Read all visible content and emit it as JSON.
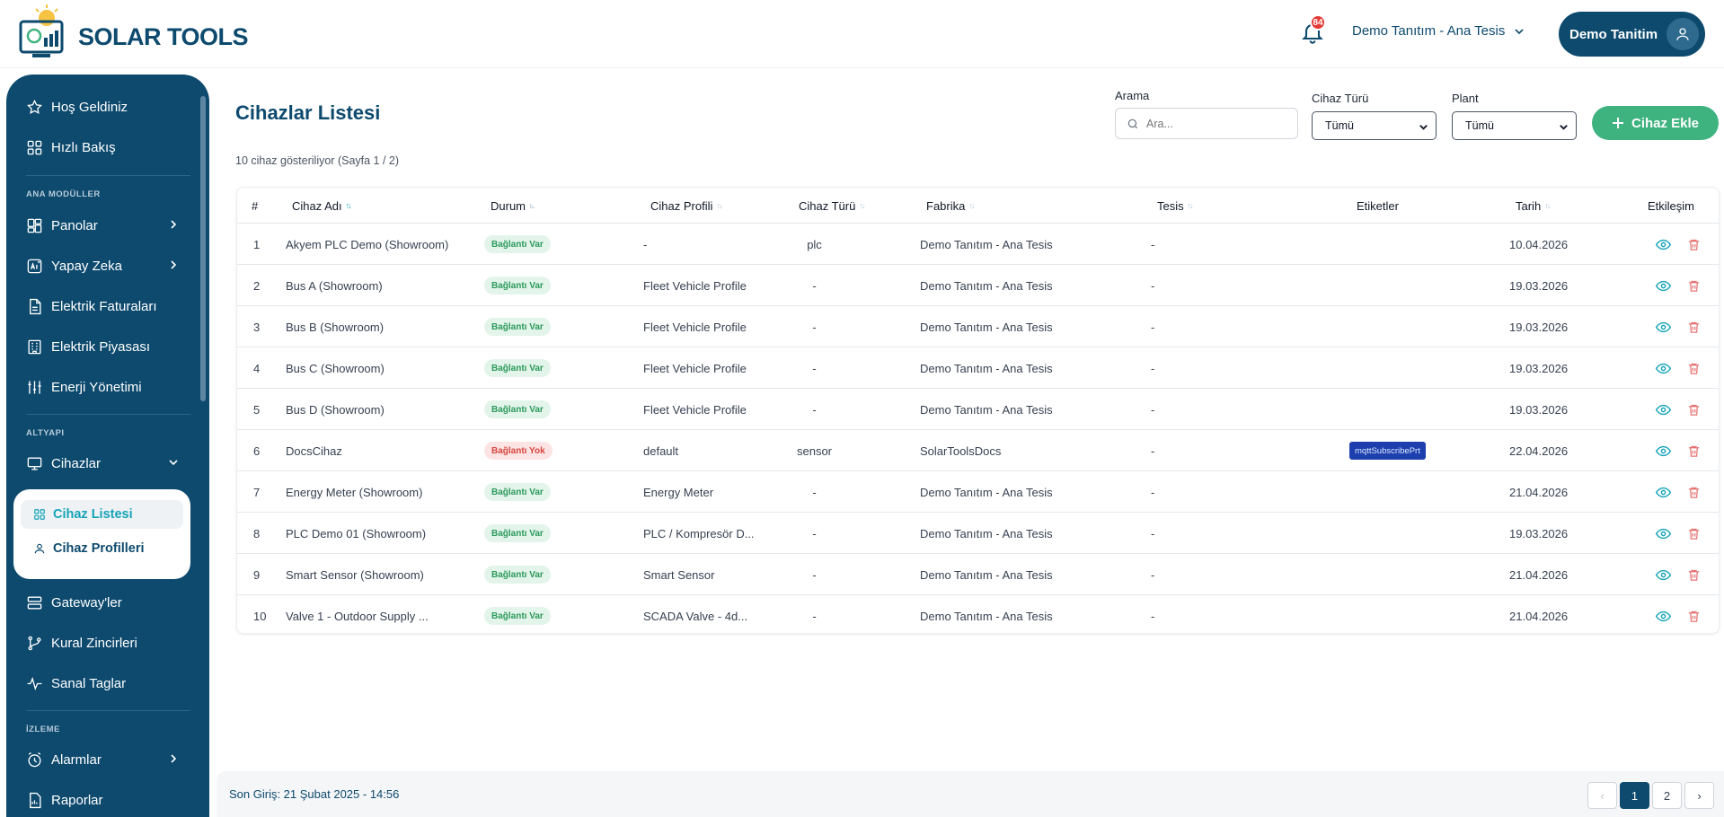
{
  "header": {
    "brand": "SOLAR TOOLS",
    "notifications": "84",
    "org_selector": "Demo Tanıtım - Ana Tesis",
    "user_name": "Demo Tanitim"
  },
  "sidebar": {
    "top_items": [
      {
        "label": "Hoş Geldiniz",
        "icon": "star-icon"
      },
      {
        "label": "Hızlı Bakış",
        "icon": "grid-icon"
      }
    ],
    "section_main": "ANA MODÜLLER",
    "main_items": [
      {
        "label": "Panolar",
        "icon": "dashboard-icon",
        "expandable": true
      },
      {
        "label": "Yapay Zeka",
        "icon": "ai-icon",
        "expandable": true
      },
      {
        "label": "Elektrik Faturaları",
        "icon": "document-icon"
      },
      {
        "label": "Elektrik Piyasası",
        "icon": "building-icon"
      },
      {
        "label": "Enerji Yönetimi",
        "icon": "sliders-icon"
      }
    ],
    "section_infra": "ALTYAPI",
    "devices": {
      "label": "Cihazlar",
      "icon": "monitor-icon"
    },
    "device_sub": [
      {
        "label": "Cihaz Listesi",
        "icon": "grid-icon",
        "active": true
      },
      {
        "label": "Cihaz Profilleri",
        "icon": "user-icon",
        "active": false
      }
    ],
    "infra_items": [
      {
        "label": "Gateway'ler",
        "icon": "gateway-icon"
      },
      {
        "label": "Kural Zincirleri",
        "icon": "branch-icon"
      },
      {
        "label": "Sanal Taglar",
        "icon": "activity-icon"
      }
    ],
    "section_monitor": "İZLEME",
    "monitor_items": [
      {
        "label": "Alarmlar",
        "icon": "alarm-clock-icon",
        "expandable": true
      },
      {
        "label": "Raporlar",
        "icon": "report-icon"
      }
    ]
  },
  "main": {
    "title": "Cihazlar Listesi",
    "summary": "10 cihaz gösteriliyor (Sayfa 1 / 2)",
    "search": {
      "label": "Arama",
      "placeholder": "Ara..."
    },
    "device_type": {
      "label": "Cihaz Türü",
      "value": "Tümü"
    },
    "plant": {
      "label": "Plant",
      "value": "Tümü"
    },
    "add_button": "Cihaz Ekle"
  },
  "table": {
    "columns": [
      "#",
      "Cihaz Adı",
      "Durum",
      "Cihaz Profili",
      "Cihaz Türü",
      "Fabrika",
      "Tesis",
      "Etiketler",
      "Tarih",
      "Etkileşim"
    ],
    "rows": [
      {
        "no": "1",
        "name": "Akyem PLC Demo (Showroom)",
        "status": "Bağlantı Var",
        "online": true,
        "profile": "-",
        "type": "plc",
        "factory": "Demo Tanıtım - Ana Tesis",
        "site": "-",
        "tags": "",
        "date": "10.04.2026"
      },
      {
        "no": "2",
        "name": "Bus A (Showroom)",
        "status": "Bağlantı Var",
        "online": true,
        "profile": "Fleet Vehicle Profile",
        "type": "-",
        "factory": "Demo Tanıtım - Ana Tesis",
        "site": "-",
        "tags": "",
        "date": "19.03.2026"
      },
      {
        "no": "3",
        "name": "Bus B (Showroom)",
        "status": "Bağlantı Var",
        "online": true,
        "profile": "Fleet Vehicle Profile",
        "type": "-",
        "factory": "Demo Tanıtım - Ana Tesis",
        "site": "-",
        "tags": "",
        "date": "19.03.2026"
      },
      {
        "no": "4",
        "name": "Bus C (Showroom)",
        "status": "Bağlantı Var",
        "online": true,
        "profile": "Fleet Vehicle Profile",
        "type": "-",
        "factory": "Demo Tanıtım - Ana Tesis",
        "site": "-",
        "tags": "",
        "date": "19.03.2026"
      },
      {
        "no": "5",
        "name": "Bus D (Showroom)",
        "status": "Bağlantı Var",
        "online": true,
        "profile": "Fleet Vehicle Profile",
        "type": "-",
        "factory": "Demo Tanıtım - Ana Tesis",
        "site": "-",
        "tags": "",
        "date": "19.03.2026"
      },
      {
        "no": "6",
        "name": "DocsCihaz",
        "status": "Bağlantı Yok",
        "online": false,
        "profile": "default",
        "type": "sensor",
        "factory": "SolarToolsDocs",
        "site": "-",
        "tags": "mqttSubscribePrt",
        "date": "22.04.2026"
      },
      {
        "no": "7",
        "name": "Energy Meter (Showroom)",
        "status": "Bağlantı Var",
        "online": true,
        "profile": "Energy Meter",
        "type": "-",
        "factory": "Demo Tanıtım - Ana Tesis",
        "site": "-",
        "tags": "",
        "date": "21.04.2026"
      },
      {
        "no": "8",
        "name": "PLC Demo 01 (Showroom)",
        "status": "Bağlantı Var",
        "online": true,
        "profile": "PLC / Kompresör D...",
        "type": "-",
        "factory": "Demo Tanıtım - Ana Tesis",
        "site": "-",
        "tags": "",
        "date": "19.03.2026"
      },
      {
        "no": "9",
        "name": "Smart Sensor (Showroom)",
        "status": "Bağlantı Var",
        "online": true,
        "profile": "Smart Sensor",
        "type": "-",
        "factory": "Demo Tanıtım - Ana Tesis",
        "site": "-",
        "tags": "",
        "date": "21.04.2026"
      },
      {
        "no": "10",
        "name": "Valve 1 - Outdoor Supply ...",
        "status": "Bağlantı Var",
        "online": true,
        "profile": "SCADA Valve - 4d...",
        "type": "-",
        "factory": "Demo Tanıtım - Ana Tesis",
        "site": "-",
        "tags": "",
        "date": "21.04.2026"
      }
    ]
  },
  "footer": {
    "last_login": "Son Giriş: 21 Şubat 2025 - 14:56",
    "pages": [
      "1",
      "2"
    ],
    "current_page": "1",
    "prev": "‹",
    "next": "›"
  },
  "colors": {
    "primary": "#0d4a6e",
    "accent": "#16a3b8",
    "success": "#3fb37f",
    "danger": "#e53935"
  }
}
